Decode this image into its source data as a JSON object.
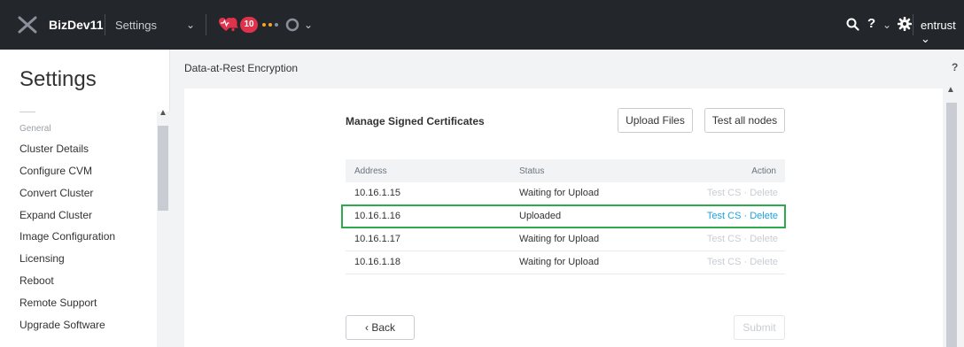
{
  "topbar": {
    "cluster_name": "BizDev11",
    "settings_label": "Settings",
    "alert_count": "10",
    "user_name": "entrust",
    "help_symbol": "?"
  },
  "sidebar": {
    "title": "Settings",
    "group_label": "General",
    "items": [
      {
        "label": "Cluster Details"
      },
      {
        "label": "Configure CVM"
      },
      {
        "label": "Convert Cluster"
      },
      {
        "label": "Expand Cluster"
      },
      {
        "label": "Image Configuration"
      },
      {
        "label": "Licensing"
      },
      {
        "label": "Reboot"
      },
      {
        "label": "Remote Support"
      },
      {
        "label": "Upgrade Software"
      }
    ]
  },
  "main": {
    "page_title": "Data-at-Rest Encryption",
    "help_symbol": "?",
    "section_title": "Manage Signed Certificates",
    "upload_label": "Upload Files",
    "test_all_label": "Test all nodes",
    "back_label": "Back",
    "submit_label": "Submit",
    "table": {
      "headers": {
        "address": "Address",
        "status": "Status",
        "action": "Action"
      },
      "action_test": "Test CS",
      "action_sep": " · ",
      "action_delete": "Delete",
      "rows": [
        {
          "address": "10.16.1.15",
          "status": "Waiting for Upload",
          "enabled": false
        },
        {
          "address": "10.16.1.16",
          "status": "Uploaded",
          "enabled": true
        },
        {
          "address": "10.16.1.17",
          "status": "Waiting for Upload",
          "enabled": false
        },
        {
          "address": "10.16.1.18",
          "status": "Waiting for Upload",
          "enabled": false
        }
      ]
    }
  },
  "colors": {
    "topbar": "#23262b",
    "alert": "#e0324b",
    "link": "#1aa3e8",
    "highlight": "#2fa84f"
  },
  "icons": [
    "nutanix-logo-icon",
    "chevron-down-icon",
    "heart-health-icon",
    "bell-icon",
    "task-circle-icon",
    "search-icon",
    "help-icon",
    "gear-icon"
  ]
}
